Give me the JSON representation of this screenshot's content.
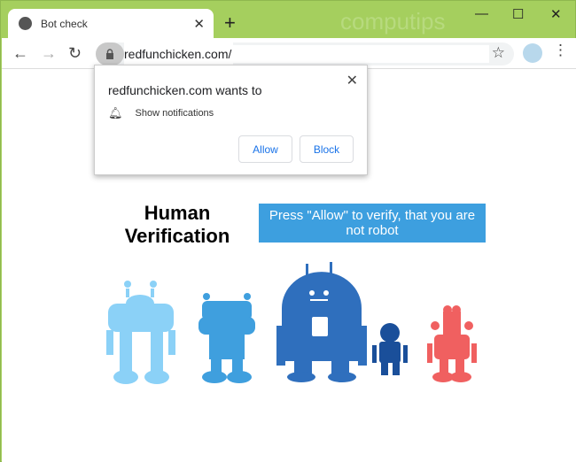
{
  "tab": {
    "title": "Bot check",
    "icon": "globe-icon"
  },
  "watermark": "computips",
  "address": {
    "url": "redfunchicken.com/"
  },
  "popup": {
    "title": "redfunchicken.com wants to",
    "permission": "Show notifications",
    "allow": "Allow",
    "block": "Block"
  },
  "page": {
    "heading_line1": "Human",
    "heading_line2": "Verification",
    "cta": "Press \"Allow\" to verify, that you are not robot"
  },
  "colors": {
    "frame": "#a5cf5e",
    "cta": "#3d9fdf",
    "robot1": "#8bd1f7",
    "robot2": "#3f9fde",
    "robot3": "#2f6fbd",
    "robot4": "#1a4f9a",
    "robot5": "#f06060"
  }
}
